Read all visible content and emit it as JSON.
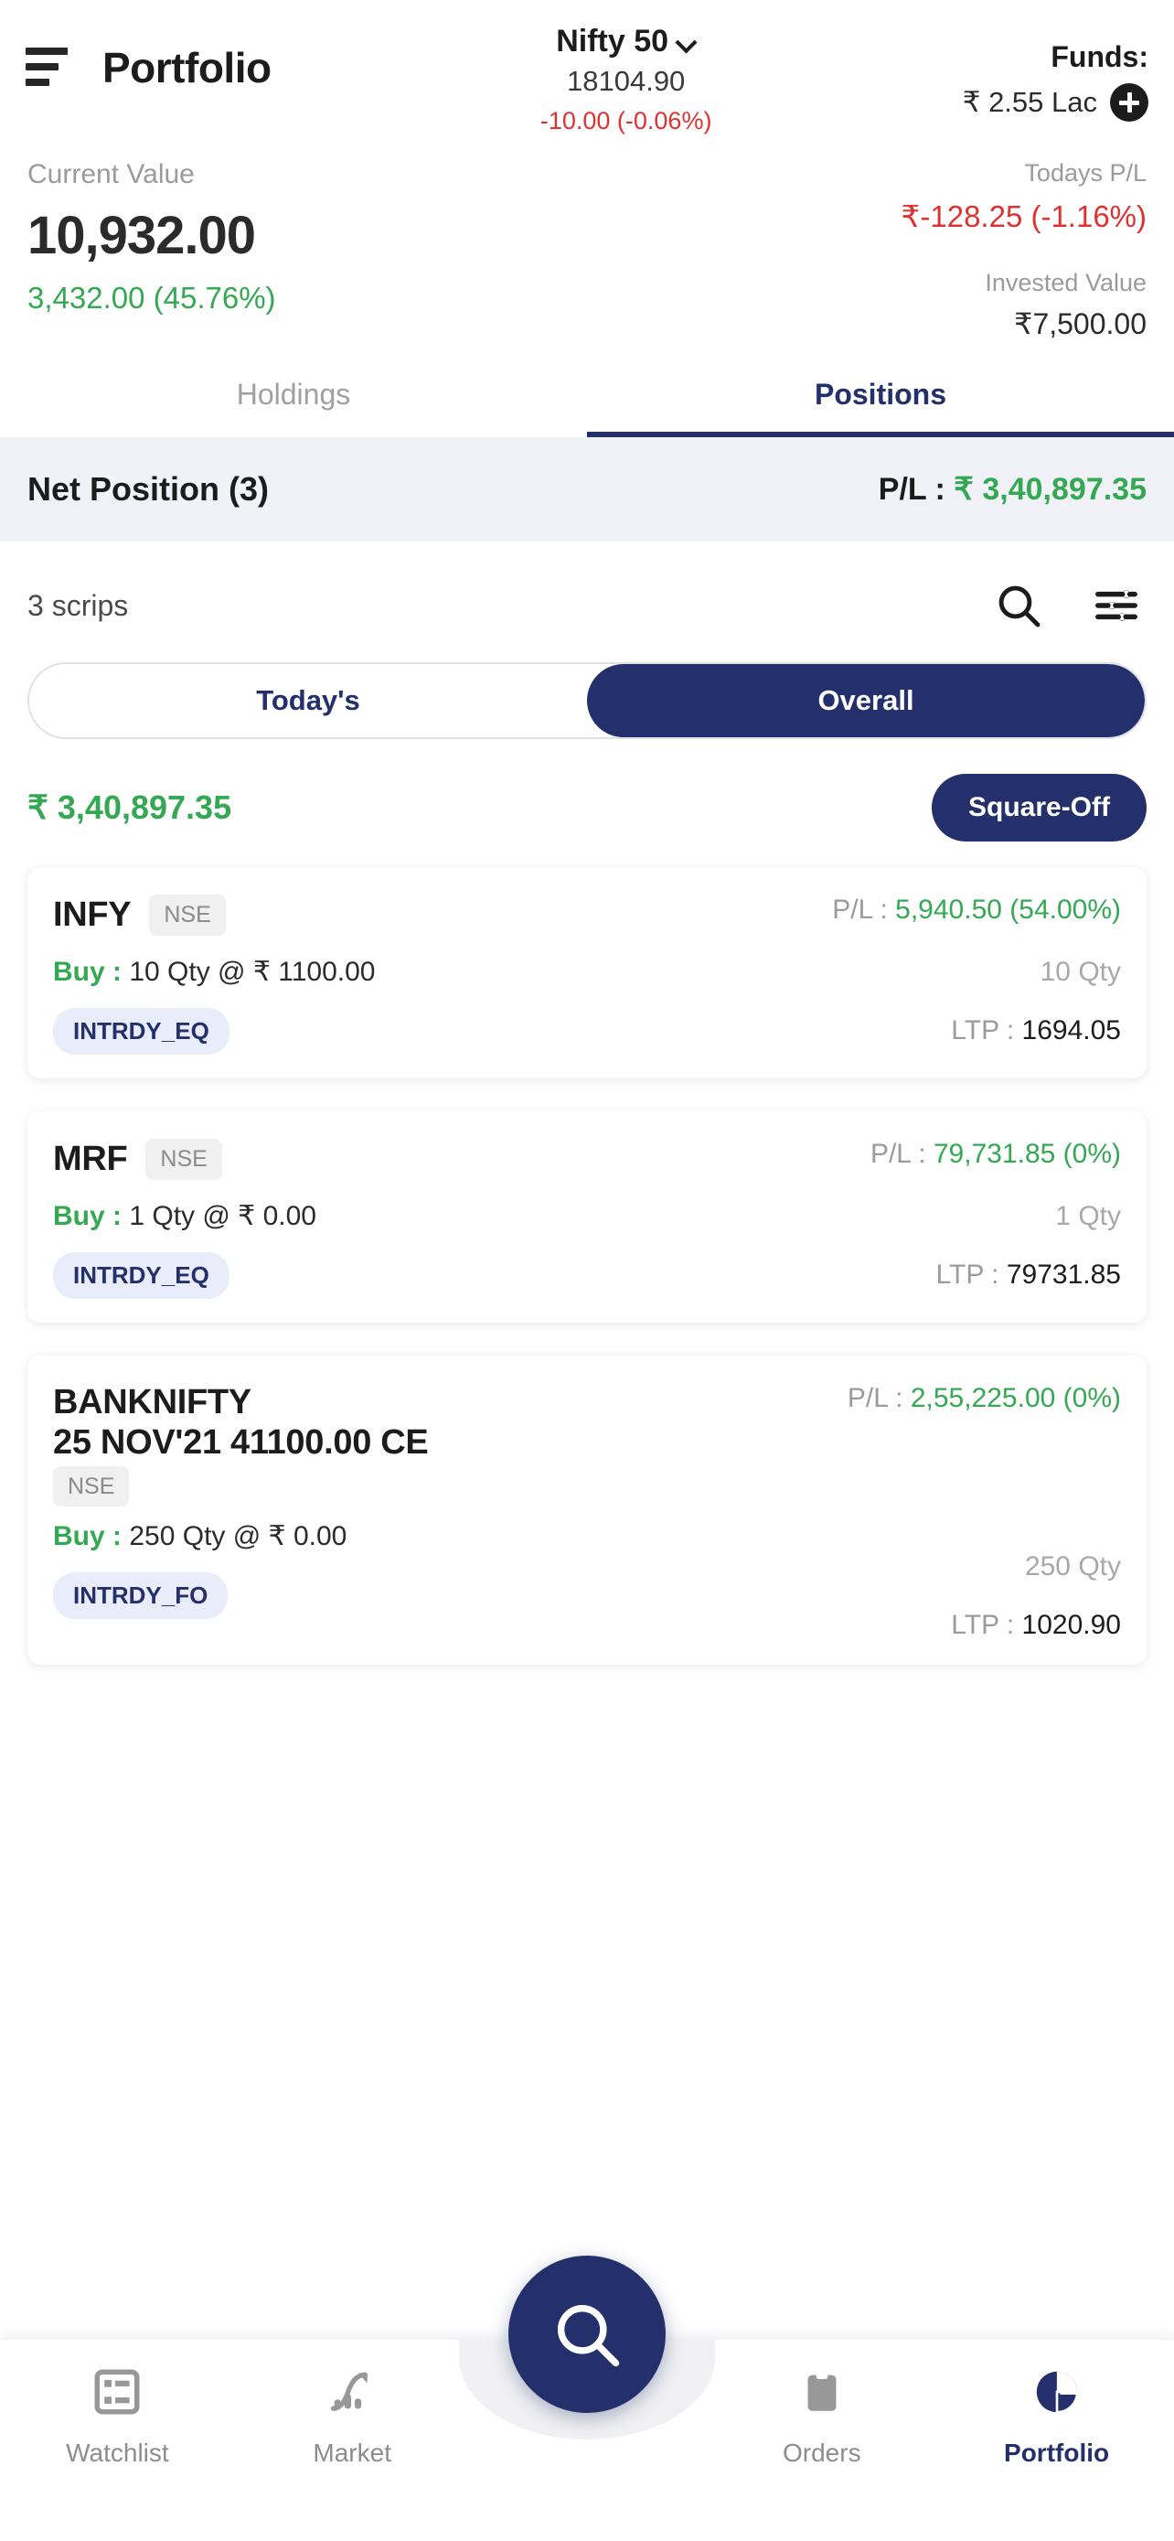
{
  "header": {
    "menu_icon": "hamburger-menu-icon",
    "title": "Portfolio",
    "index": {
      "name": "Nifty 50",
      "dropdown_icon": "chevron-down-icon",
      "ltp": "18104.90",
      "change": "-10.00 (-0.06%)",
      "change_color": "#e03131"
    },
    "funds": {
      "label": "Funds:",
      "amount": "₹ 2.55 Lac",
      "add_icon": "plus-circle-icon"
    }
  },
  "summary": {
    "current_value_label": "Current Value",
    "current_value": "10,932.00",
    "overall_change": "3,432.00 (45.76%)",
    "overall_change_color": "#34a853",
    "todays_pl_label": "Todays P/L",
    "todays_pl": "₹-128.25 (-1.16%)",
    "todays_pl_color": "#e03131",
    "invested_value_label": "Invested Value",
    "invested_value": "₹7,500.00"
  },
  "tabs": [
    {
      "label": "Holdings",
      "active": false
    },
    {
      "label": "Positions",
      "active": true
    }
  ],
  "net_position": {
    "title": "Net Position (3)",
    "pl_label": "P/L : ",
    "pl_value": "₹ 3,40,897.35",
    "pl_color": "#34a853"
  },
  "list_header": {
    "count": "3 scrips",
    "search_icon": "search-icon",
    "filter_icon": "filter-sliders-icon"
  },
  "segment": [
    {
      "label": "Today's",
      "active": false
    },
    {
      "label": "Overall",
      "active": true
    }
  ],
  "pl_bar": {
    "amount": "₹ 3,40,897.35",
    "amount_color": "#34a853",
    "square_off_label": "Square-Off"
  },
  "positions": [
    {
      "symbol": "INFY",
      "symbol_line2": "",
      "exchange": "NSE",
      "side": "Buy : ",
      "order": "10 Qty @ ₹ 1100.00",
      "product": "INTRDY_EQ",
      "pl_label": "P/L : ",
      "pl_value": "5,940.50 (54.00%)",
      "pl_color": "#34a853",
      "qty": "10 Qty",
      "ltp_label": "LTP : ",
      "ltp_value": "1694.05"
    },
    {
      "symbol": "MRF",
      "symbol_line2": "",
      "exchange": "NSE",
      "side": "Buy : ",
      "order": "1 Qty @ ₹ 0.00",
      "product": "INTRDY_EQ",
      "pl_label": "P/L : ",
      "pl_value": "79,731.85 (0%)",
      "pl_color": "#34a853",
      "qty": "1 Qty",
      "ltp_label": "LTP : ",
      "ltp_value": "79731.85"
    },
    {
      "symbol": "BANKNIFTY",
      "symbol_line2": "25 NOV'21 41100.00 CE",
      "exchange": "NSE",
      "side": "Buy : ",
      "order": "250 Qty @ ₹ 0.00",
      "product": "INTRDY_FO",
      "pl_label": "P/L : ",
      "pl_value": "2,55,225.00 (0%)",
      "pl_color": "#34a853",
      "qty": "250 Qty",
      "ltp_label": "LTP : ",
      "ltp_value": "1020.90"
    }
  ],
  "fab": {
    "icon": "search-icon"
  },
  "bottom_nav": [
    {
      "label": "Watchlist",
      "icon": "list-grid-icon",
      "active": false
    },
    {
      "label": "Market",
      "icon": "chart-trending-up-icon",
      "active": false
    },
    {
      "label": "Orders",
      "icon": "clipboard-icon",
      "active": false
    },
    {
      "label": "Portfolio",
      "icon": "pie-chart-icon",
      "active": true
    }
  ],
  "theme": {
    "primary": "#23306b",
    "positive": "#34a853",
    "negative": "#e03131",
    "muted": "#9b9b9b"
  }
}
